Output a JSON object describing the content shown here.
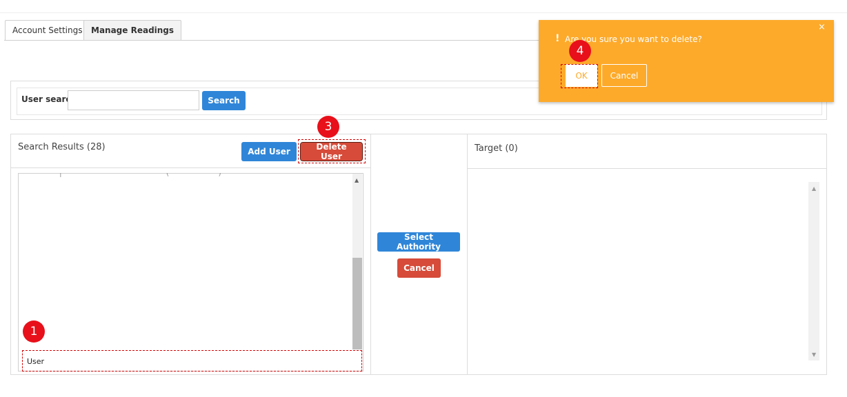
{
  "tabs": [
    {
      "label": "Account Settings"
    },
    {
      "label": "Manage Readings"
    }
  ],
  "search": {
    "label": "User search",
    "value": "",
    "button_label": "Search"
  },
  "results": {
    "title": "Search Results (28)",
    "add_user_label": "Add User",
    "delete_user_label": "Delete User",
    "clipped_row_text": "─ ┴ ─ ─ ┬ ─ ─ ─ ─ ─ ┘ ─ ─ ─ ─ ─ ( ─ ─ ─ ─ ─ )",
    "selected_row_label": "User"
  },
  "middle": {
    "select_authority_label": "Select Authority",
    "cancel_label": "Cancel"
  },
  "target": {
    "title": "Target (0)"
  },
  "markers": {
    "m1": "1",
    "m3": "3",
    "m4": "4"
  },
  "dialog": {
    "message": "Are you sure you want to delete?",
    "ok_label": "OK",
    "cancel_label": "Cancel",
    "close_glyph": "×",
    "alert_glyph": "!"
  },
  "icons": {
    "scroll_up": "▲",
    "scroll_down": "▼"
  },
  "colors": {
    "primary": "#2f86d8",
    "danger": "#d64b39",
    "dialog": "#fdaa2b",
    "marker": "#e8101a"
  }
}
